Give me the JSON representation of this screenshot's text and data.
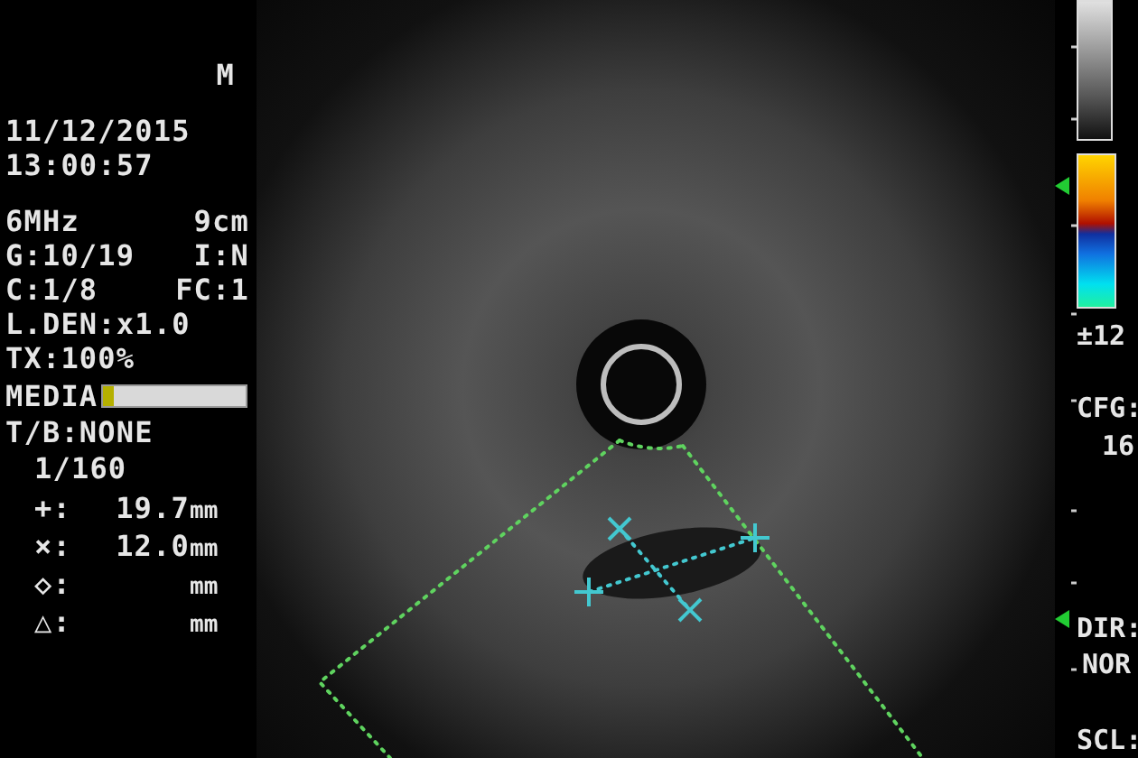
{
  "header": {
    "mode": "M",
    "date": "11/12/2015",
    "time": "13:00:57"
  },
  "settings": [
    {
      "left": "6MHz",
      "right": "9cm"
    },
    {
      "left": "G:10/19",
      "right": "I:N"
    },
    {
      "left": "C:1/8",
      "right": "FC:1"
    },
    {
      "left": "L.DEN:x1.0"
    },
    {
      "left": "TX:100%"
    }
  ],
  "media": {
    "label": "MEDIA",
    "level": 0.07
  },
  "tb": "T/B:NONE",
  "frame": "1/160",
  "measurements": [
    {
      "symbol": "+:",
      "value": "19.7",
      "unit": "mm"
    },
    {
      "symbol": "×:",
      "value": "12.0",
      "unit": "mm"
    },
    {
      "symbol": "◇:",
      "unit": "mm"
    },
    {
      "symbol": "△:",
      "unit": "mm"
    }
  ],
  "right_panel": {
    "scale_range": "±12",
    "cfg_label": "CFG:",
    "cfg_value": "16",
    "dir_label": "DIR:",
    "dir_value": "NOR",
    "scl_label": "SCL:"
  }
}
